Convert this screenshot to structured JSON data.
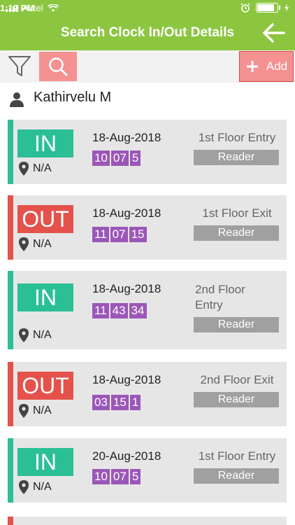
{
  "status": {
    "carrier": "Airtel",
    "time": "1:12 PM"
  },
  "header": {
    "title": "Search Clock In/Out Details"
  },
  "toolbar": {
    "add_label": "Add"
  },
  "user": {
    "name": "Kathirvelu M"
  },
  "colors": {
    "green": "#8cc640",
    "in": "#2bbf96",
    "out": "#e4524b",
    "time": "#9b57b7",
    "reader": "#a0a0a0",
    "button": "#f49191"
  },
  "entries": [
    {
      "type": "IN",
      "date": "18-Aug-2018",
      "time": [
        "10",
        "07",
        "5"
      ],
      "place": "1st Floor Entry",
      "device": "Reader",
      "location": "N/A"
    },
    {
      "type": "OUT",
      "date": "18-Aug-2018",
      "time": [
        "11",
        "07",
        "15"
      ],
      "place": "1st Floor Exit",
      "device": "Reader",
      "location": "N/A"
    },
    {
      "type": "IN",
      "date": "18-Aug-2018",
      "time": [
        "11",
        "43",
        "34"
      ],
      "place": "2nd Floor Entry",
      "device": "Reader",
      "location": "N/A"
    },
    {
      "type": "OUT",
      "date": "18-Aug-2018",
      "time": [
        "03",
        "15",
        "1"
      ],
      "place": "2nd Floor Exit",
      "device": "Reader",
      "location": "N/A"
    },
    {
      "type": "IN",
      "date": "20-Aug-2018",
      "time": [
        "10",
        "07",
        "5"
      ],
      "place": "1st Floor Entry",
      "device": "Reader",
      "location": "N/A"
    }
  ]
}
